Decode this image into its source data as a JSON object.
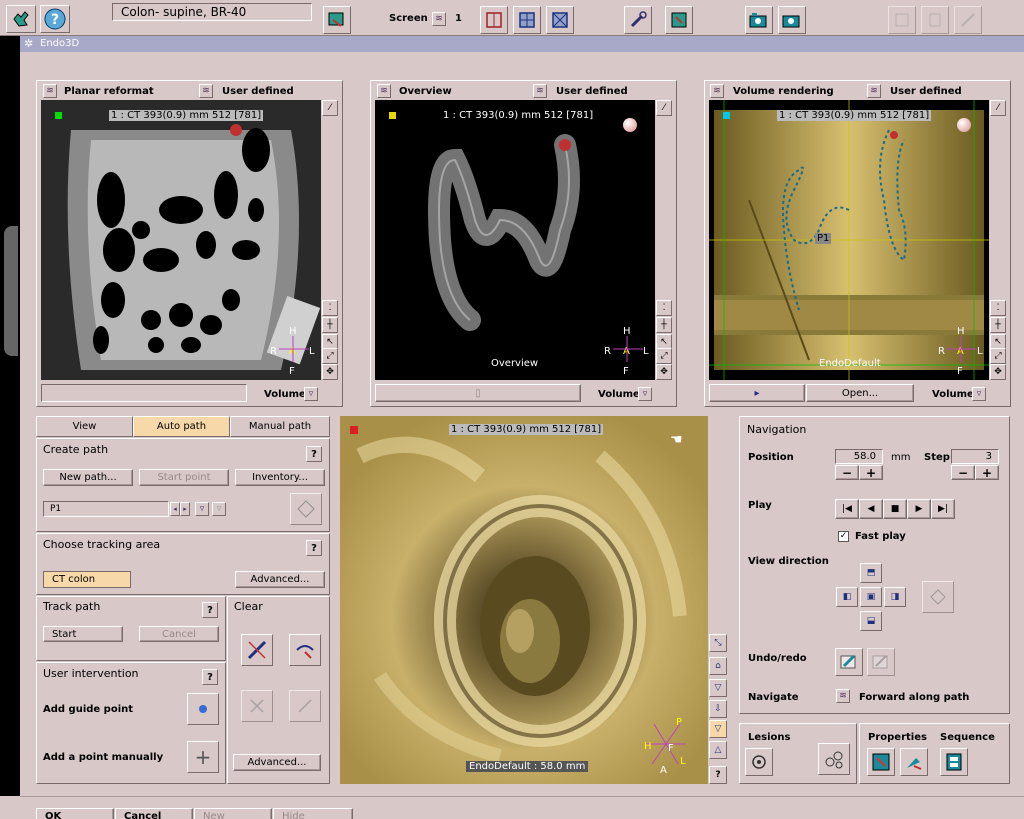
{
  "toolbar": {
    "study_title": "Colon- supine, BR-40",
    "screen_label": "Screen",
    "screen_number": "1"
  },
  "window": {
    "title": "Endo3D"
  },
  "views": [
    {
      "name": "Planar reformat",
      "preset": "User defined",
      "info": "1 : CT  393(0.9) mm 512 [781]",
      "volume_label": "Volume"
    },
    {
      "name": "Overview",
      "preset": "User defined",
      "info": "1 : CT  393(0.9) mm 512 [781]",
      "volume_label": "Volume",
      "bottom_label": "Overview"
    },
    {
      "name": "Volume rendering",
      "preset": "User defined",
      "info": "1 : CT  393(0.9) mm 512 [781]",
      "volume_label": "Volume",
      "bottom_label": "EndoDefault",
      "open_label": "Open...",
      "marker_label": "P1"
    }
  ],
  "orientation": {
    "top": "H",
    "bottom": "F",
    "left": "R",
    "right": "L",
    "center": "A"
  },
  "endo_orientation": {
    "p": "P",
    "h": "H",
    "a": "A",
    "l": "L",
    "f": "F"
  },
  "tabs": [
    "View",
    "Auto path",
    "Manual path"
  ],
  "create_path": {
    "title": "Create path",
    "new_path": "New path...",
    "start_point": "Start point",
    "inventory": "Inventory...",
    "path_value": "P1"
  },
  "tracking": {
    "title": "Choose tracking area",
    "area_value": "CT colon",
    "advanced": "Advanced..."
  },
  "track_path": {
    "title": "Track path",
    "start": "Start",
    "cancel": "Cancel"
  },
  "clear": {
    "title": "Clear"
  },
  "user_intervention": {
    "title": "User intervention",
    "add_guide_point": "Add guide point",
    "add_point_manually": "Add a point manually",
    "advanced": "Advanced..."
  },
  "endo_view": {
    "info": "1 : CT  393(0.9) mm 512 [781]",
    "bottom": "EndoDefault : 58.0 mm"
  },
  "navigation": {
    "title": "Navigation",
    "position_label": "Position",
    "position_value": "58.0",
    "position_unit": "mm",
    "step_label": "Step",
    "step_value": "3",
    "play_label": "Play",
    "fast_play_label": "Fast play",
    "view_direction_label": "View direction",
    "undo_redo_label": "Undo/redo",
    "navigate_label": "Navigate",
    "navigate_value": "Forward along path"
  },
  "bottom_tools": {
    "lesions": "Lesions",
    "properties": "Properties",
    "sequence": "Sequence"
  },
  "dialog_buttons": {
    "ok": "OK",
    "cancel": "Cancel",
    "new": "New",
    "hide": "Hide"
  },
  "colors": {
    "background": "#d8c8c8",
    "title_bar": "#a8a8c8",
    "active_tab": "#f7d8a8",
    "volume_gold": "#c8b06a"
  }
}
